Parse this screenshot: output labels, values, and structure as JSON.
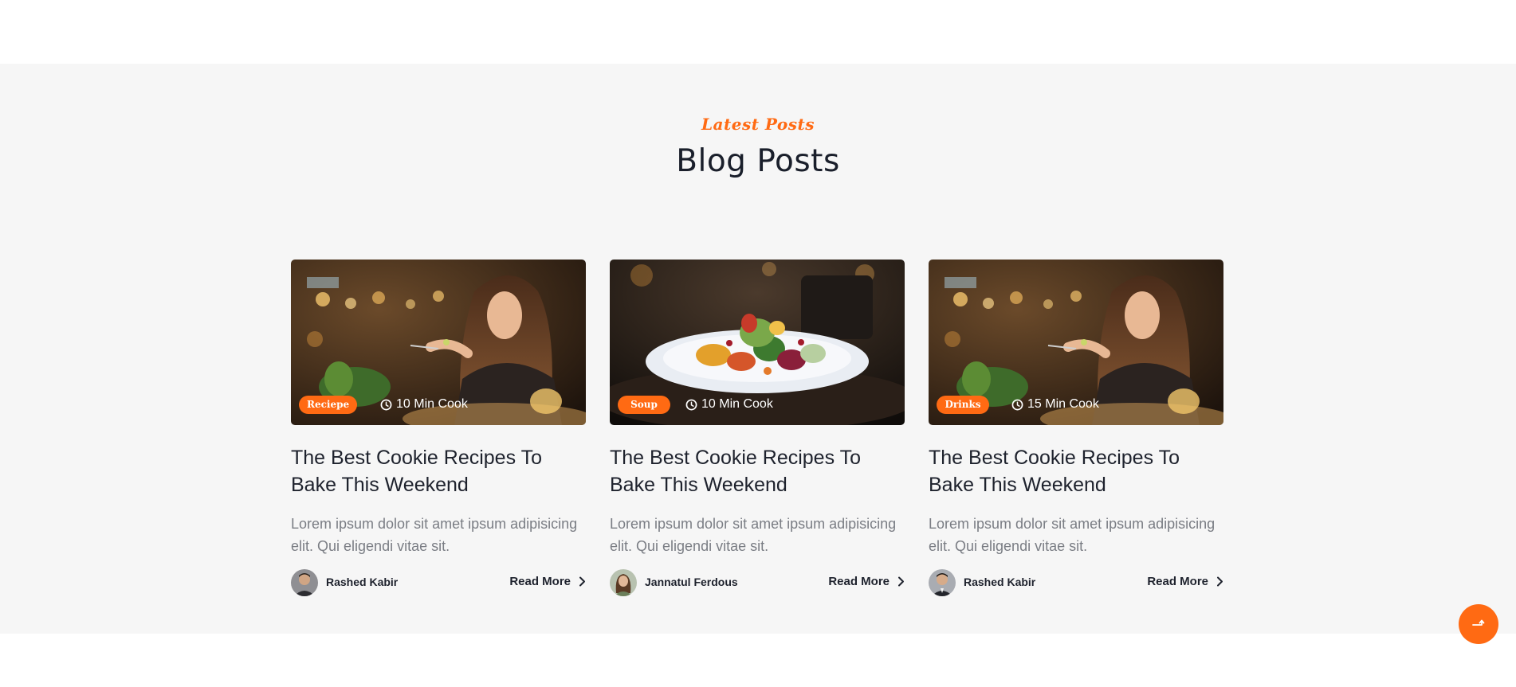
{
  "section": {
    "subtitle": "Latest Posts",
    "title": "Blog Posts"
  },
  "posts": [
    {
      "category": "Reciepe",
      "cook_time": "10 Min Cook",
      "title": "The Best Cookie Recipes To Bake This Weekend",
      "excerpt": "Lorem ipsum dolor sit amet ipsum adipisicing elit. Qui eligendi vitae sit.",
      "author": "Rashed Kabir",
      "read_more": "Read More",
      "image": "woman-eating-icon"
    },
    {
      "category": "Soup",
      "cook_time": "10 Min Cook",
      "title": "The Best Cookie Recipes To Bake This Weekend",
      "excerpt": "Lorem ipsum dolor sit amet ipsum adipisicing elit. Qui eligendi vitae sit.",
      "author": "Jannatul Ferdous",
      "read_more": "Read More",
      "image": "salad-plate-icon"
    },
    {
      "category": "Drinks",
      "cook_time": "15 Min Cook",
      "title": "The Best Cookie Recipes To Bake This Weekend",
      "excerpt": "Lorem ipsum dolor sit amet ipsum adipisicing elit. Qui eligendi vitae sit.",
      "author": "Rashed Kabir",
      "read_more": "Read More",
      "image": "woman-eating-icon"
    }
  ],
  "colors": {
    "accent": "#ff6a13",
    "section_bg": "#f6f6f6",
    "heading": "#1a1f2b",
    "body_text": "#7a7d84"
  },
  "icons": {
    "clock": "clock-icon",
    "read_more": "chevron-right-icon",
    "scroll_top": "scroll-to-top-icon"
  }
}
